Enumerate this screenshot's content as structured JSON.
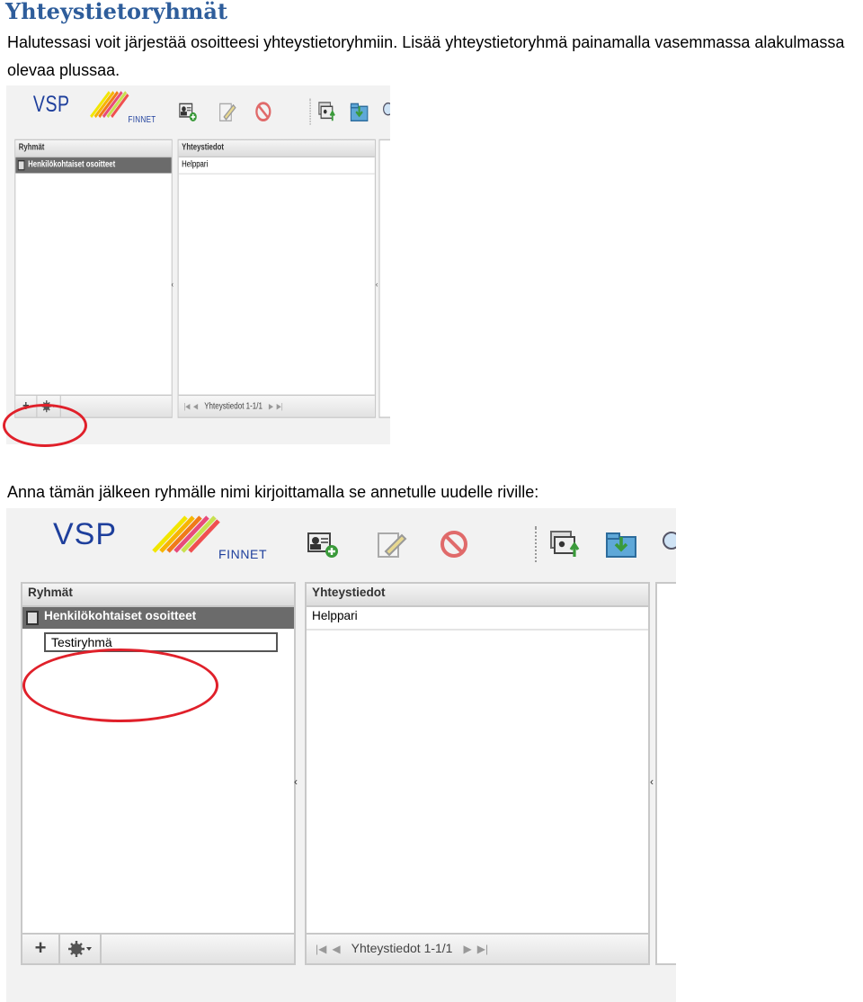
{
  "heading": "Yhteystietoryhmät",
  "paragraph1": "Halutessasi voit järjestää osoitteesi yhteystietoryhmiin. Lisää yhteystietoryhmä painamalla vasemmassa alakulmassa olevaa plussaa.",
  "paragraph2": "Anna tämän jälkeen ryhmälle nimi kirjoittamalla se annetulle uudelle riville:",
  "app": {
    "logo_text": "VSP",
    "logo_subtext": "FINNET",
    "groups_header": "Ryhmät",
    "contacts_header": "Yhteystiedot",
    "group_name": "Henkilökohtaiset osoitteet",
    "contact_name": "Helppari",
    "new_group_value": "Testiryhmä",
    "add_symbol": "+",
    "pager_text": "Yhteystiedot 1-1/1",
    "accent_red": "#e0202a",
    "icons": [
      "add-contact-icon",
      "edit-icon",
      "delete-icon",
      "move-contacts-icon",
      "import-icon",
      "search-icon"
    ]
  }
}
